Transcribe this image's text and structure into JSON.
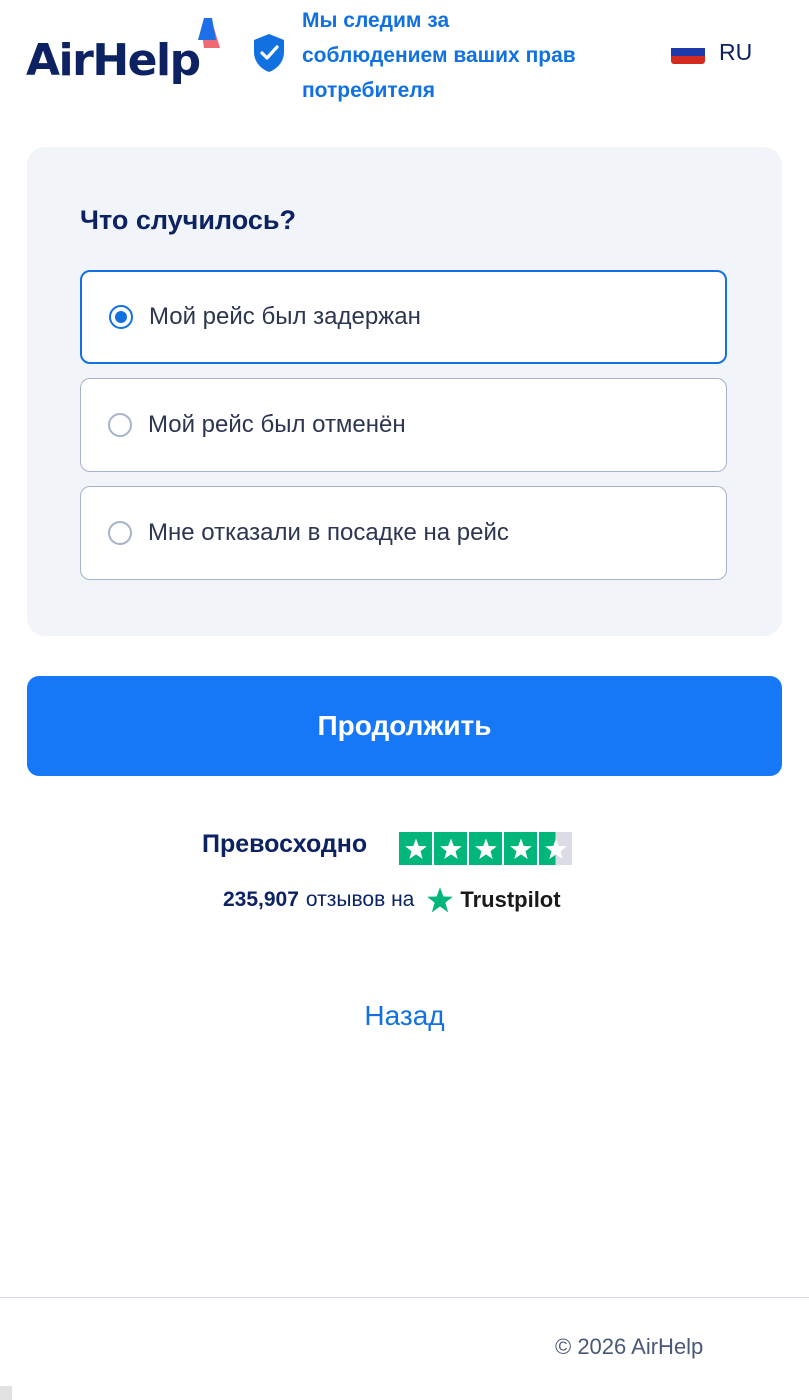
{
  "header": {
    "logo_text": "AirHelp",
    "tagline_lines": [
      "Мы следим за",
      "соблюдением ваших прав",
      "потребителя"
    ],
    "language": {
      "code": "RU",
      "flag_colors": [
        "#ffffff",
        "#1c3aa9",
        "#d52b1e"
      ]
    }
  },
  "form": {
    "question": "Что случилось?",
    "options": [
      {
        "label": "Мой рейс был задержан",
        "selected": true
      },
      {
        "label": "Мой рейс был отменён",
        "selected": false
      },
      {
        "label": "Мне отказали в посадке на рейс",
        "selected": false
      }
    ],
    "continue_label": "Продолжить"
  },
  "rating": {
    "word": "Превосходно",
    "stars": 4.5,
    "reviews_count": "235,907",
    "reviews_suffix": "отзывов на",
    "platform": "Trustpilot"
  },
  "back_label": "Назад",
  "footer": {
    "copyright": "© 2026 AirHelp"
  },
  "colors": {
    "brand_navy": "#0c2262",
    "accent_blue": "#1271e0",
    "button_blue": "#1677f7",
    "trustpilot_green": "#00b67a",
    "card_bg": "#f1f4f9"
  }
}
